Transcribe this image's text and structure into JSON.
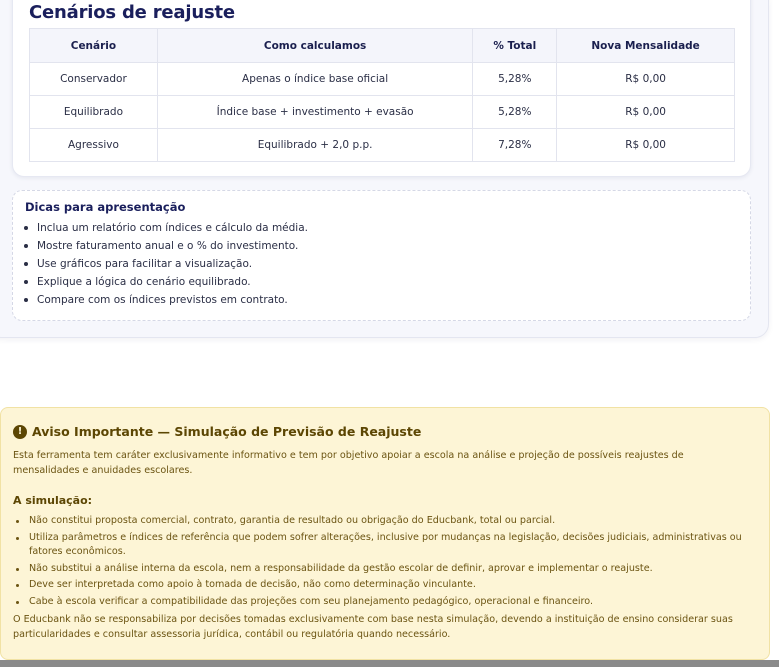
{
  "scenarios": {
    "title": "Cenários de reajuste",
    "headers": [
      "Cenário",
      "Como calculamos",
      "% Total",
      "Nova Mensalidade"
    ],
    "rows": [
      {
        "name": "Conservador",
        "method": "Apenas o índice base oficial",
        "total": "5,28%",
        "value": "R$ 0,00"
      },
      {
        "name": "Equilibrado",
        "method": "Índice base + investimento + evasão",
        "total": "5,28%",
        "value": "R$ 0,00"
      },
      {
        "name": "Agressivo",
        "method": "Equilibrado + 2,0 p.p.",
        "total": "7,28%",
        "value": "R$ 0,00"
      }
    ]
  },
  "tips": {
    "title": "Dicas para apresentação",
    "items": [
      "Inclua um relatório com índices e cálculo da média.",
      "Mostre faturamento anual e o % do investimento.",
      "Use gráficos para facilitar a visualização.",
      "Explique a lógica do cenário equilibrado.",
      "Compare com os índices previstos em contrato."
    ]
  },
  "warning": {
    "icon": "exclamation-icon",
    "title": "Aviso Importante — Simulação de Previsão de Reajuste",
    "intro": "Esta ferramenta tem caráter exclusivamente informativo e tem por objetivo apoiar a escola na análise e projeção de possíveis reajustes de mensalidades e anuidades escolares.",
    "simulation_label": "A simulação:",
    "items": [
      "Não constitui proposta comercial, contrato, garantia de resultado ou obrigação do Educbank, total ou parcial.",
      "Utiliza parâmetros e índices de referência que podem sofrer alterações, inclusive por mudanças na legislação, decisões judiciais, administrativas ou fatores econômicos.",
      "Não substitui a análise interna da escola, nem a responsabilidade da gestão escolar de definir, aprovar e implementar o reajuste.",
      "Deve ser interpretada como apoio à tomada de decisão, não como determinação vinculante.",
      "Cabe à escola verificar a compatibilidade das projeções com seu planejamento pedagógico, operacional e financeiro."
    ],
    "footer": "O Educbank não se responsabiliza por decisões tomadas exclusivamente com base nesta simulação, devendo a instituição de ensino considerar suas particularidades e consultar assessoria jurídica, contábil ou regulatória quando necessário."
  }
}
